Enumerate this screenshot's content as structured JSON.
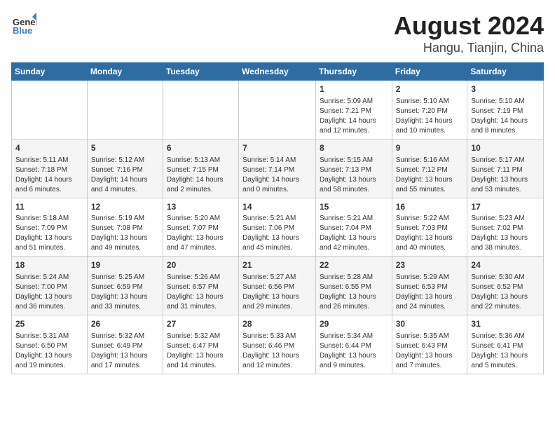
{
  "header": {
    "logo_line1": "General",
    "logo_line2": "Blue",
    "title": "August 2024",
    "subtitle": "Hangu, Tianjin, China"
  },
  "weekdays": [
    "Sunday",
    "Monday",
    "Tuesday",
    "Wednesday",
    "Thursday",
    "Friday",
    "Saturday"
  ],
  "weeks": [
    [
      {
        "day": "",
        "info": ""
      },
      {
        "day": "",
        "info": ""
      },
      {
        "day": "",
        "info": ""
      },
      {
        "day": "",
        "info": ""
      },
      {
        "day": "1",
        "info": "Sunrise: 5:09 AM\nSunset: 7:21 PM\nDaylight: 14 hours and 12 minutes."
      },
      {
        "day": "2",
        "info": "Sunrise: 5:10 AM\nSunset: 7:20 PM\nDaylight: 14 hours and 10 minutes."
      },
      {
        "day": "3",
        "info": "Sunrise: 5:10 AM\nSunset: 7:19 PM\nDaylight: 14 hours and 8 minutes."
      }
    ],
    [
      {
        "day": "4",
        "info": "Sunrise: 5:11 AM\nSunset: 7:18 PM\nDaylight: 14 hours and 6 minutes."
      },
      {
        "day": "5",
        "info": "Sunrise: 5:12 AM\nSunset: 7:16 PM\nDaylight: 14 hours and 4 minutes."
      },
      {
        "day": "6",
        "info": "Sunrise: 5:13 AM\nSunset: 7:15 PM\nDaylight: 14 hours and 2 minutes."
      },
      {
        "day": "7",
        "info": "Sunrise: 5:14 AM\nSunset: 7:14 PM\nDaylight: 14 hours and 0 minutes."
      },
      {
        "day": "8",
        "info": "Sunrise: 5:15 AM\nSunset: 7:13 PM\nDaylight: 13 hours and 58 minutes."
      },
      {
        "day": "9",
        "info": "Sunrise: 5:16 AM\nSunset: 7:12 PM\nDaylight: 13 hours and 55 minutes."
      },
      {
        "day": "10",
        "info": "Sunrise: 5:17 AM\nSunset: 7:11 PM\nDaylight: 13 hours and 53 minutes."
      }
    ],
    [
      {
        "day": "11",
        "info": "Sunrise: 5:18 AM\nSunset: 7:09 PM\nDaylight: 13 hours and 51 minutes."
      },
      {
        "day": "12",
        "info": "Sunrise: 5:19 AM\nSunset: 7:08 PM\nDaylight: 13 hours and 49 minutes."
      },
      {
        "day": "13",
        "info": "Sunrise: 5:20 AM\nSunset: 7:07 PM\nDaylight: 13 hours and 47 minutes."
      },
      {
        "day": "14",
        "info": "Sunrise: 5:21 AM\nSunset: 7:06 PM\nDaylight: 13 hours and 45 minutes."
      },
      {
        "day": "15",
        "info": "Sunrise: 5:21 AM\nSunset: 7:04 PM\nDaylight: 13 hours and 42 minutes."
      },
      {
        "day": "16",
        "info": "Sunrise: 5:22 AM\nSunset: 7:03 PM\nDaylight: 13 hours and 40 minutes."
      },
      {
        "day": "17",
        "info": "Sunrise: 5:23 AM\nSunset: 7:02 PM\nDaylight: 13 hours and 38 minutes."
      }
    ],
    [
      {
        "day": "18",
        "info": "Sunrise: 5:24 AM\nSunset: 7:00 PM\nDaylight: 13 hours and 36 minutes."
      },
      {
        "day": "19",
        "info": "Sunrise: 5:25 AM\nSunset: 6:59 PM\nDaylight: 13 hours and 33 minutes."
      },
      {
        "day": "20",
        "info": "Sunrise: 5:26 AM\nSunset: 6:57 PM\nDaylight: 13 hours and 31 minutes."
      },
      {
        "day": "21",
        "info": "Sunrise: 5:27 AM\nSunset: 6:56 PM\nDaylight: 13 hours and 29 minutes."
      },
      {
        "day": "22",
        "info": "Sunrise: 5:28 AM\nSunset: 6:55 PM\nDaylight: 13 hours and 26 minutes."
      },
      {
        "day": "23",
        "info": "Sunrise: 5:29 AM\nSunset: 6:53 PM\nDaylight: 13 hours and 24 minutes."
      },
      {
        "day": "24",
        "info": "Sunrise: 5:30 AM\nSunset: 6:52 PM\nDaylight: 13 hours and 22 minutes."
      }
    ],
    [
      {
        "day": "25",
        "info": "Sunrise: 5:31 AM\nSunset: 6:50 PM\nDaylight: 13 hours and 19 minutes."
      },
      {
        "day": "26",
        "info": "Sunrise: 5:32 AM\nSunset: 6:49 PM\nDaylight: 13 hours and 17 minutes."
      },
      {
        "day": "27",
        "info": "Sunrise: 5:32 AM\nSunset: 6:47 PM\nDaylight: 13 hours and 14 minutes."
      },
      {
        "day": "28",
        "info": "Sunrise: 5:33 AM\nSunset: 6:46 PM\nDaylight: 13 hours and 12 minutes."
      },
      {
        "day": "29",
        "info": "Sunrise: 5:34 AM\nSunset: 6:44 PM\nDaylight: 13 hours and 9 minutes."
      },
      {
        "day": "30",
        "info": "Sunrise: 5:35 AM\nSunset: 6:43 PM\nDaylight: 13 hours and 7 minutes."
      },
      {
        "day": "31",
        "info": "Sunrise: 5:36 AM\nSunset: 6:41 PM\nDaylight: 13 hours and 5 minutes."
      }
    ]
  ]
}
